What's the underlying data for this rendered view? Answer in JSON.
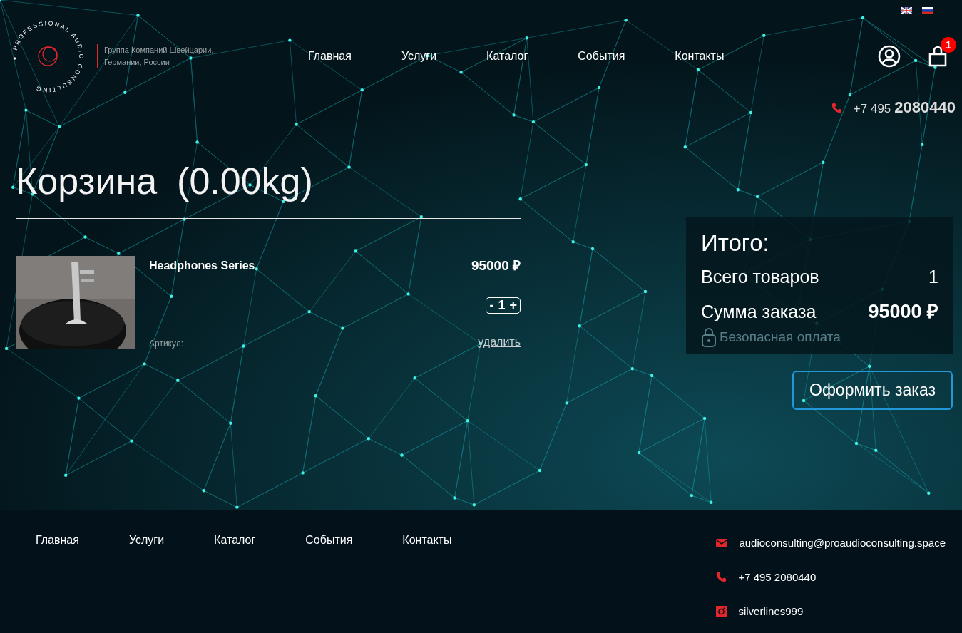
{
  "header": {
    "logo_ring_text": "PROFESSIONAL AUDIO CONSULTING",
    "tagline": "Группа Компаний Швейцарии, Германии, России",
    "nav": [
      "Главная",
      "Услуги",
      "Каталог",
      "События",
      "Контакты"
    ],
    "cart_badge": "1",
    "phone": {
      "prefix": "+7 495",
      "number": "2080440"
    }
  },
  "cart": {
    "title": "Корзина",
    "weight": "(0.00kg)",
    "items": [
      {
        "kind": "picture",
        "name": "Headphones Series",
        "price": "95000 ₽",
        "minus": "-",
        "quantity": "1",
        "plus": "+",
        "sku_label": "Артикул:",
        "remove": "удалить"
      }
    ]
  },
  "summary": {
    "title": "Итого:",
    "rows": [
      {
        "kind": "count",
        "label": "Всего товаров",
        "value": "1"
      },
      {
        "kind": "total",
        "label": "Сумма заказа",
        "value": "95000 ₽"
      }
    ],
    "secure": "Безопасная оплата",
    "checkout": "Оформить заказ"
  },
  "footer": {
    "nav": [
      "Главная",
      "Услуги",
      "Каталог",
      "События",
      "Контакты"
    ],
    "contacts": [
      {
        "kind": "email",
        "text": "audioconsulting@proaudioconsulting.space"
      },
      {
        "kind": "phone",
        "text": "+7 495 2080440"
      },
      {
        "kind": "instagram",
        "text": "silverlines999"
      }
    ]
  }
}
